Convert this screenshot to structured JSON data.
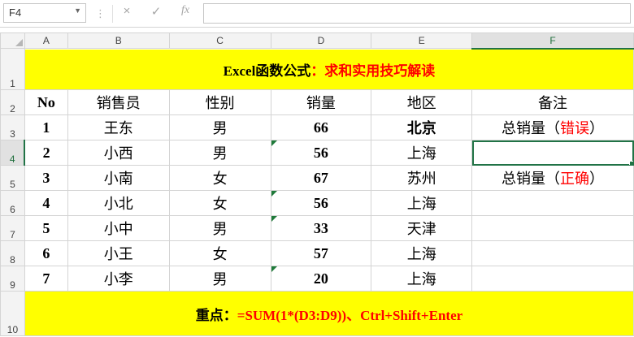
{
  "formula_bar": {
    "name_box": "F4",
    "cancel_icon": "×",
    "confirm_icon": "✓",
    "fx_label": "fx",
    "formula_value": ""
  },
  "columns": [
    "A",
    "B",
    "C",
    "D",
    "E",
    "F"
  ],
  "rows": [
    "1",
    "2",
    "3",
    "4",
    "5",
    "6",
    "7",
    "8",
    "9",
    "10"
  ],
  "sheet": {
    "title_prefix": "Excel函数公式",
    "title_suffix": "：求和实用技巧解读",
    "headers": [
      "No",
      "销售员",
      "性别",
      "销量",
      "地区",
      "备注"
    ],
    "data_rows": [
      [
        "1",
        "王东",
        "男",
        "66",
        "北京"
      ],
      [
        "2",
        "小西",
        "男",
        "56",
        "上海"
      ],
      [
        "3",
        "小南",
        "女",
        "67",
        "苏州"
      ],
      [
        "4",
        "小北",
        "女",
        "56",
        "上海"
      ],
      [
        "5",
        "小中",
        "男",
        "33",
        "天津"
      ],
      [
        "6",
        "小王",
        "女",
        "57",
        "上海"
      ],
      [
        "7",
        "小李",
        "男",
        "20",
        "上海"
      ]
    ],
    "note_f3": {
      "label": "总销量",
      "open": "（",
      "status": "错误",
      "close": "）"
    },
    "note_f5": {
      "label": "总销量",
      "open": "（",
      "status": "正确",
      "close": "）"
    },
    "footer_label": "重点：",
    "footer_formula": "=SUM(1*(D3:D9))、Ctrl+Shift+Enter"
  },
  "active_cell": "F4",
  "colors": {
    "highlight": "#ffff00",
    "accent_text": "#ff0000",
    "selection": "#217346"
  }
}
